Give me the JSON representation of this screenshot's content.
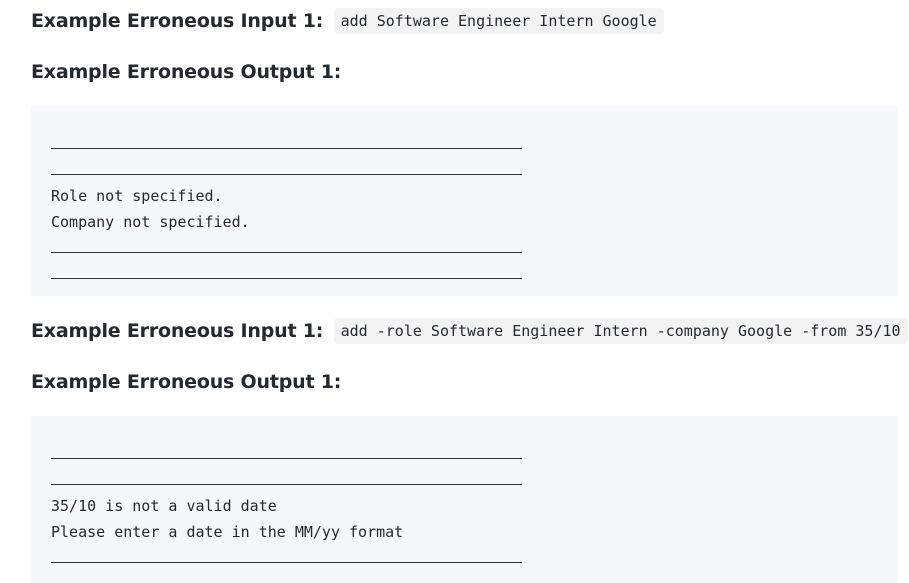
{
  "examples": [
    {
      "input_label": "Example Erroneous Input 1:",
      "input_code": "add Software Engineer Intern Google",
      "output_label": "Example Erroneous Output 1:",
      "output_lines": [
        "Role not specified.",
        "Company not specified."
      ]
    },
    {
      "input_label": "Example Erroneous Input 1:",
      "input_code": "add -role Software Engineer Intern -company Google -from 35/10",
      "output_label": "Example Erroneous Output 1:",
      "output_lines": [
        "35/10 is not a valid date",
        "Please enter a date in the MM/yy format"
      ]
    }
  ]
}
